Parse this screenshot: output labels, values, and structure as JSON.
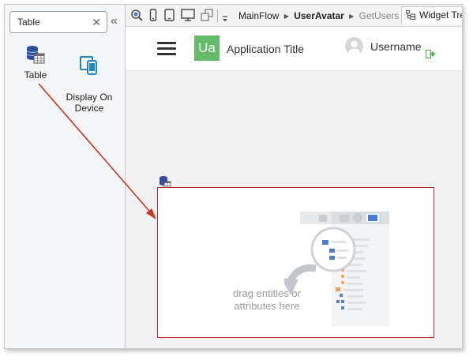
{
  "toolbox": {
    "search_value": "Table",
    "clear_icon": "close-icon",
    "collapse_icon": "double-chevron-left-icon",
    "widgets": [
      {
        "label": "Table",
        "icon": "table-widget-icon"
      },
      {
        "label": "Display On\nDevice",
        "icon": "display-on-device-icon"
      }
    ]
  },
  "toolbar": {
    "breadcrumb": {
      "flow": "MainFlow",
      "screen": "UserAvatar",
      "action": "GetUsers"
    },
    "widget_tree_label": "Widget Tre"
  },
  "app": {
    "logo_text": "Ua",
    "title": "Application Title",
    "username": "Username",
    "colors": {
      "logo": "#66bb6a",
      "logout": "#4caf50"
    }
  },
  "table": {
    "placeholder_line1": "drag entities or",
    "placeholder_line2": "attributes here",
    "border_color": "#c62828"
  },
  "annotation": {
    "arrow_color": "#d0341f"
  }
}
